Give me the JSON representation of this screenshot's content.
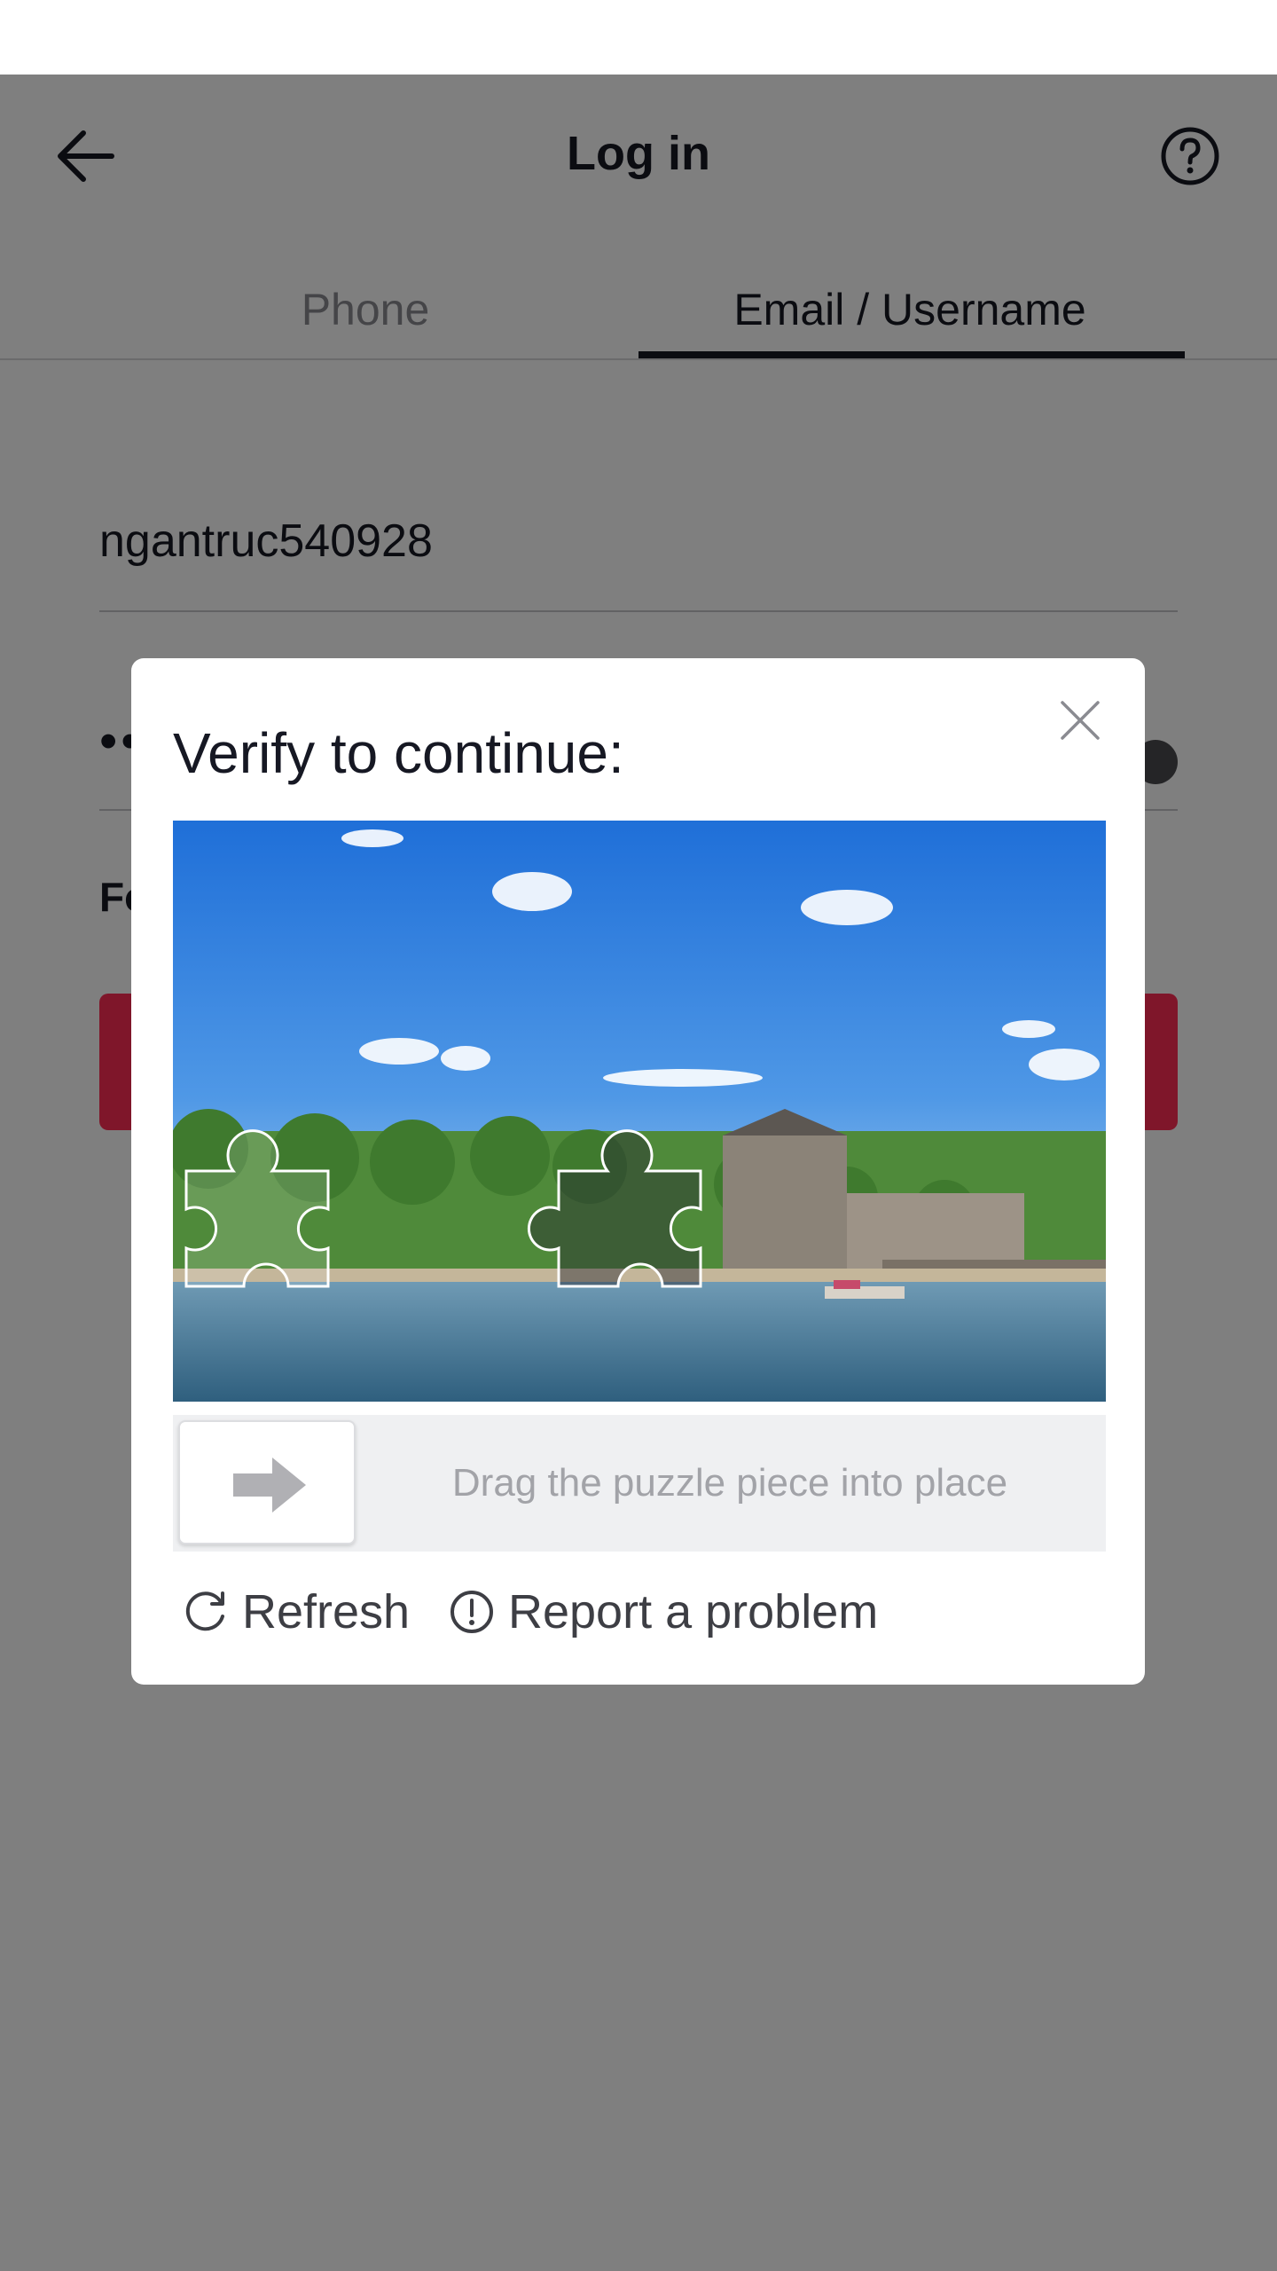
{
  "header": {
    "title": "Log in",
    "back_icon": "arrow-left-icon",
    "help_icon": "question-circle-icon"
  },
  "tabs": [
    {
      "label": "Phone",
      "active": false
    },
    {
      "label": "Email / Username",
      "active": true
    }
  ],
  "form": {
    "username_value": "ngantruc540928",
    "password_value": "••",
    "forgot_label": "Fo",
    "login_button_color": "#fe2c55"
  },
  "captcha": {
    "title": "Verify to continue:",
    "slider_hint": "Drag the puzzle piece into place",
    "refresh_label": "Refresh",
    "report_label": "Report a problem",
    "close_icon": "close-icon",
    "refresh_icon": "refresh-icon",
    "report_icon": "exclamation-circle-icon",
    "handle_icon": "arrow-right-icon"
  },
  "colors": {
    "accent": "#fe2c55",
    "text_primary": "#161823",
    "text_secondary": "#8a8b91",
    "overlay": "rgba(0,0,0,0.5)"
  }
}
